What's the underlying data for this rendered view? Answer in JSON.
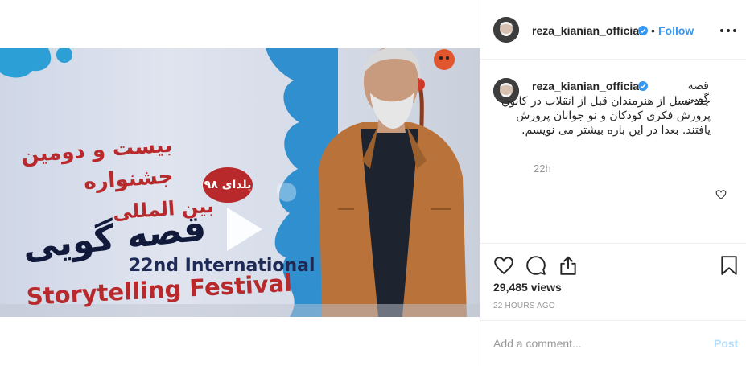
{
  "post": {
    "username": "reza_kianian_official",
    "verified": true,
    "follow_label": "Follow",
    "separator": "•",
    "caption_first_line": "قصه گویی...",
    "caption_body": "چند نسل از هنرمندان قبل از انقلاب در کانون پرورش فکری کودکان و نو جوانان پرورش یافتند. بعدا در این باره بیشتر می نویسم.",
    "relative_time": "22h",
    "views_label": "29,485 views",
    "posted_time": "22 HOURS AGO"
  },
  "media": {
    "poster_fa_line1": "بیست و دومین",
    "poster_fa_line2": "جشنواره",
    "poster_fa_line3": "بین المللی",
    "poster_fa_title": "قصه گویی",
    "poster_badge": "یلدای ۹۸",
    "poster_en_line1": "22nd International",
    "poster_en_line2": "Storytelling Festival"
  },
  "comment_box": {
    "placeholder": "Add a comment...",
    "post_label": "Post"
  },
  "icons": {
    "more": "more-options-icon",
    "like": "heart-icon",
    "comment": "comment-icon",
    "share": "share-icon",
    "save": "bookmark-icon",
    "verified": "verified-badge-icon",
    "play": "play-icon"
  },
  "colors": {
    "link_blue": "#3897f0",
    "post_disabled": "#b2dffc",
    "muted": "#999999",
    "poster_red": "#b8292c",
    "poster_navy": "#1e2a55"
  }
}
